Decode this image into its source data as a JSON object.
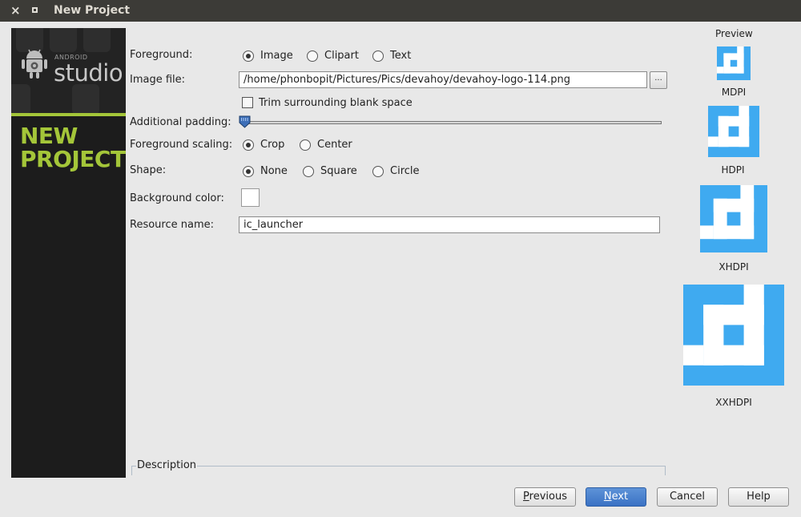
{
  "window": {
    "title": "New Project",
    "close_glyph": "×"
  },
  "banner": {
    "brand_small": "ANDROID",
    "brand_big": "studio",
    "headline_line1": "NEW",
    "headline_line2": "PROJECT",
    "accent_color": "#a4c639"
  },
  "form": {
    "foreground": {
      "label": "Foreground:",
      "options": [
        "Image",
        "Clipart",
        "Text"
      ],
      "selected": "Image"
    },
    "image_file": {
      "label": "Image file:",
      "value": "/home/phonbopit/Pictures/Pics/devahoy/devahoy-logo-114.png",
      "browse_label": "..."
    },
    "trim": {
      "label": "Trim surrounding blank space",
      "checked": false
    },
    "padding": {
      "label": "Additional padding:",
      "value_percent": 0
    },
    "scaling": {
      "label": "Foreground scaling:",
      "options": [
        "Crop",
        "Center"
      ],
      "selected": "Crop"
    },
    "shape": {
      "label": "Shape:",
      "options": [
        "None",
        "Square",
        "Circle"
      ],
      "selected": "None"
    },
    "background_color": {
      "label": "Background color:",
      "value": "#ffffff"
    },
    "resource_name": {
      "label": "Resource name:",
      "value": "ic_launcher"
    }
  },
  "description": {
    "label": "Description"
  },
  "preview": {
    "title": "Preview",
    "icon_color": "#3faaf0",
    "densities": [
      "MDPI",
      "HDPI",
      "XHDPI",
      "XXHDPI"
    ]
  },
  "buttons": {
    "previous": {
      "mnemonic": "P",
      "rest": "revious"
    },
    "next": {
      "mnemonic": "N",
      "rest": "ext"
    },
    "cancel": "Cancel",
    "help": "Help"
  }
}
